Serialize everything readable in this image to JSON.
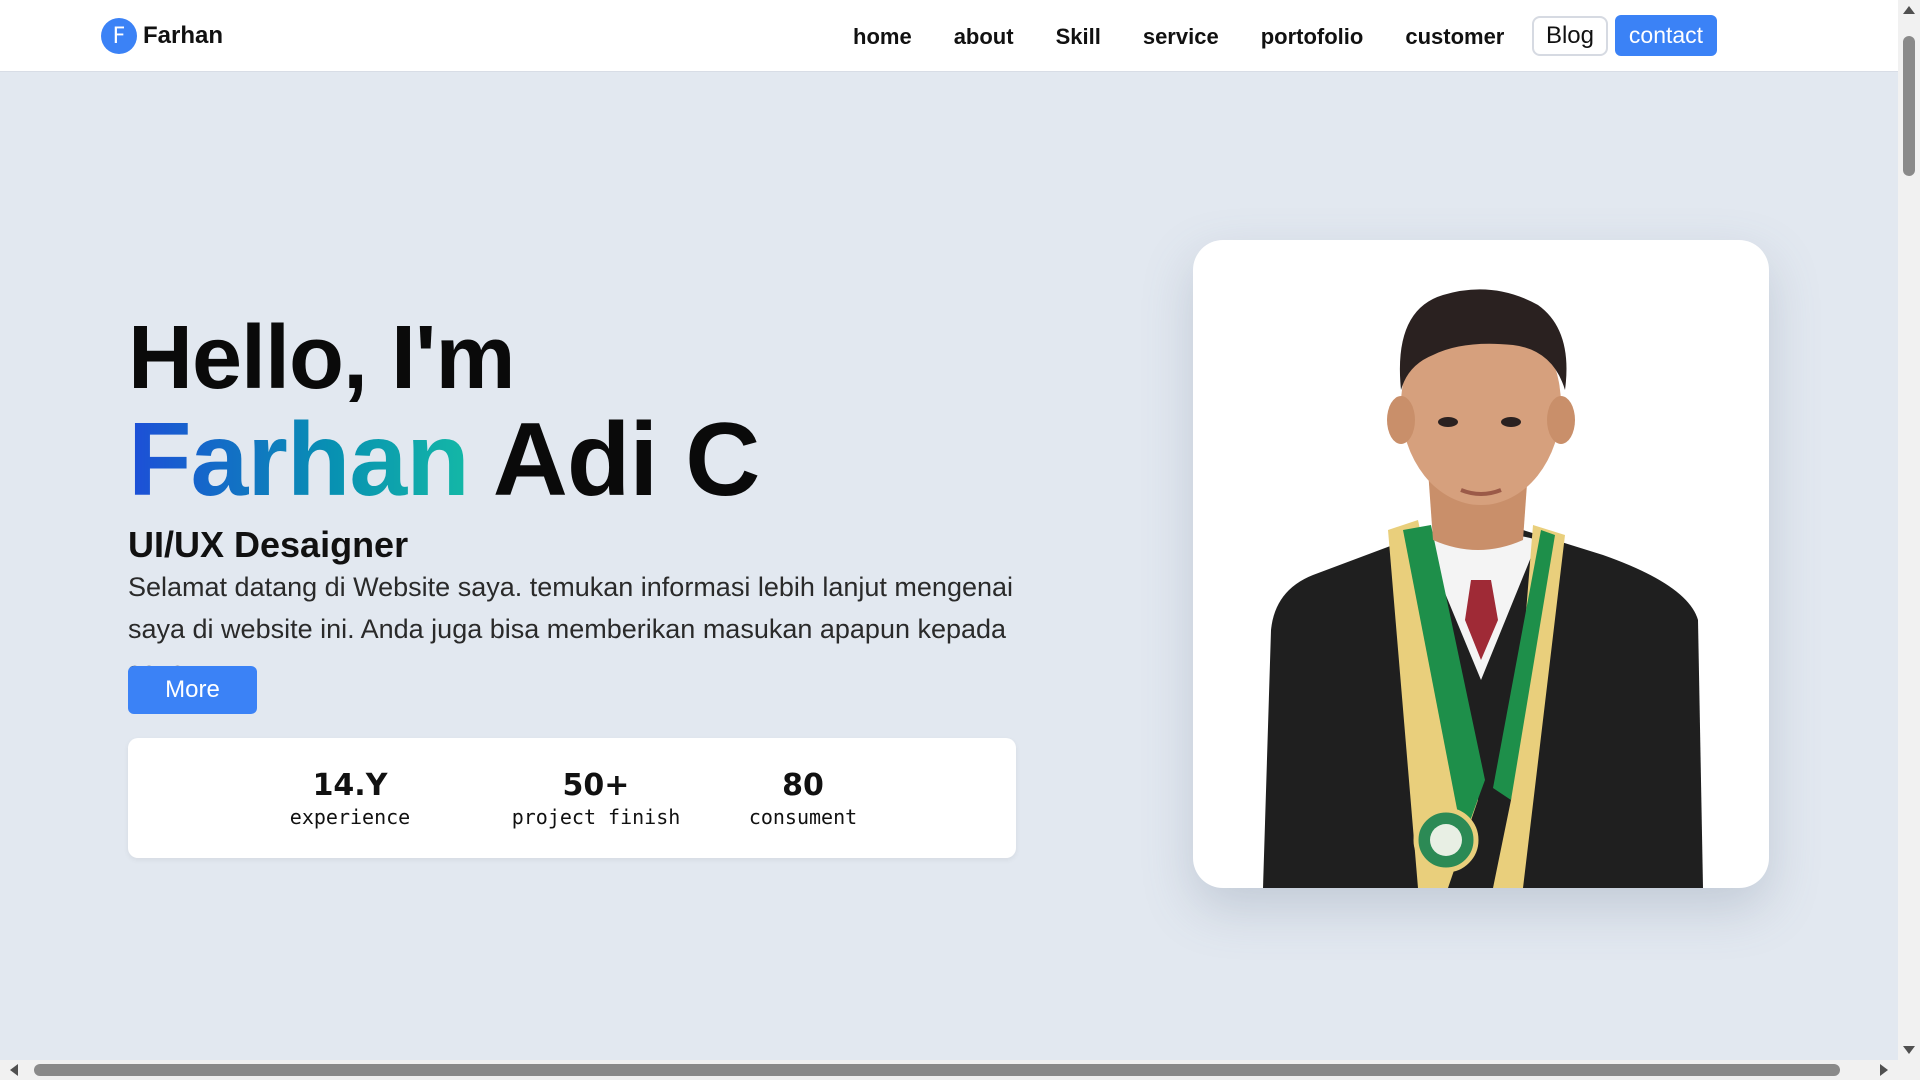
{
  "nav": {
    "brand_letter": "F",
    "brand_name": "Farhan",
    "links": [
      "home",
      "about",
      "Skill",
      "service",
      "portofolio",
      "customer"
    ],
    "blog_label": "Blog",
    "contact_label": "contact"
  },
  "hero": {
    "greeting": "Hello, I'm",
    "name_first": "Farhan",
    "name_rest": "Adi C",
    "role": "UI/UX Desaigner",
    "description": "Selamat datang di Website saya. temukan informasi lebih lanjut mengenai saya di website ini. Anda juga bisa memberikan masukan apapun kepada saya",
    "more_label": "More"
  },
  "stats": [
    {
      "value": "14.Y",
      "label": "experience"
    },
    {
      "value": "50+",
      "label": "project finish"
    },
    {
      "value": "80",
      "label": "consument"
    }
  ],
  "colors": {
    "accent": "#3b82f6",
    "background": "#e2e8f0",
    "name_gradient_start": "#1d4ed8",
    "name_gradient_end": "#14b8a6"
  }
}
